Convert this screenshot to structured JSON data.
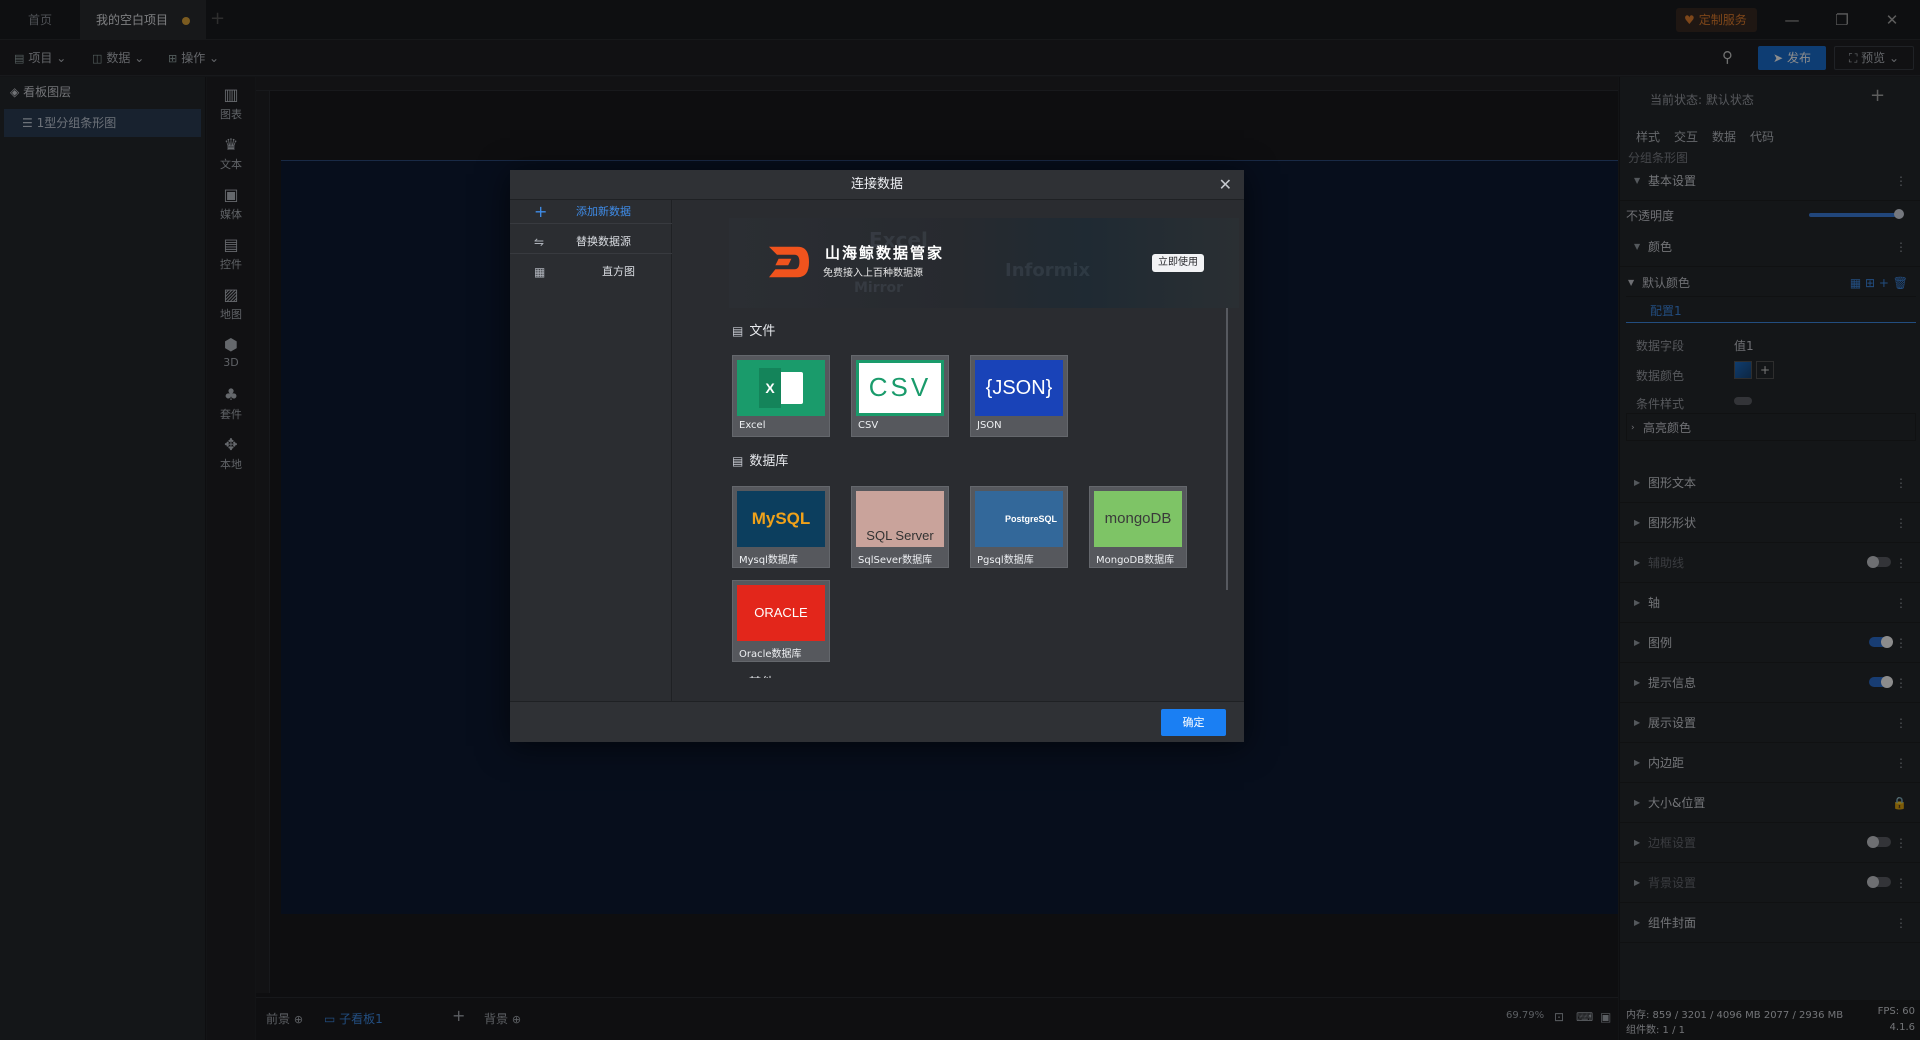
{
  "titlebar": {
    "tabs": [
      "首页",
      "我的空白项目"
    ],
    "custom_service": "定制服务"
  },
  "toolbar": {
    "menus": [
      "项目",
      "数据",
      "操作"
    ],
    "publish": "发布",
    "preview": "预览"
  },
  "layers": {
    "title": "看板图层",
    "item": "1型分组条形图"
  },
  "rail": [
    "图表",
    "文本",
    "媒体",
    "控件",
    "地图",
    "3D",
    "套件",
    "本地"
  ],
  "bottom": {
    "front": "前景",
    "child": "子看板1",
    "bg": "背景",
    "zoom": "69.79%"
  },
  "modal": {
    "title": "连接数据",
    "side": {
      "add": "添加新数据",
      "replace": "替换数据源",
      "chart": "直方图"
    },
    "banner": {
      "title": "山海鲸数据管家",
      "subtitle": "免费接入上百种数据源",
      "button": "立即使用"
    },
    "sections": {
      "file": "文件",
      "db": "数据库",
      "other": "其他"
    },
    "file_cards": [
      {
        "label": "Excel",
        "thumb": "X"
      },
      {
        "label": "CSV",
        "thumb": "CSV"
      },
      {
        "label": "JSON",
        "thumb": "{JSON}"
      }
    ],
    "db_cards": [
      {
        "label": "Mysql数据库",
        "thumb": "MySQL"
      },
      {
        "label": "SqlSever数据库",
        "thumb": "SQL Server"
      },
      {
        "label": "Pgsql数据库",
        "thumb": "PostgreSQL"
      },
      {
        "label": "MongoDB数据库",
        "thumb": "mongoDB"
      },
      {
        "label": "Oracle数据库",
        "thumb": "ORACLE"
      }
    ],
    "confirm": "确定"
  },
  "rpanel": {
    "state": "当前状态: 默认状态",
    "tabs": [
      "样式",
      "交互",
      "数据",
      "代码"
    ],
    "component_name": "分组条形图",
    "basic": "基本设置",
    "opacity_label": "不透明度",
    "opacity_value": "100",
    "opacity_unit": "%",
    "color": "颜色",
    "default_color": "默认颜色",
    "config_tab": "配置1",
    "data_field_label": "数据字段",
    "data_field_value": "值1",
    "data_color_label": "数据颜色",
    "cond_style_label": "条件样式",
    "highlight": "高亮颜色",
    "sections": [
      "图形文本",
      "图形形状",
      "辅助线",
      "轴",
      "图例",
      "提示信息",
      "展示设置",
      "内边距",
      "大小&位置",
      "边框设置",
      "背景设置",
      "组件封面"
    ],
    "footer_mem": "内存: 859 / 3201 / 4096 MB 2077 / 2936 MB",
    "footer_fps": "FPS: 60",
    "footer_count": "组件数: 1 / 1",
    "footer_ver": "4.1.6"
  }
}
